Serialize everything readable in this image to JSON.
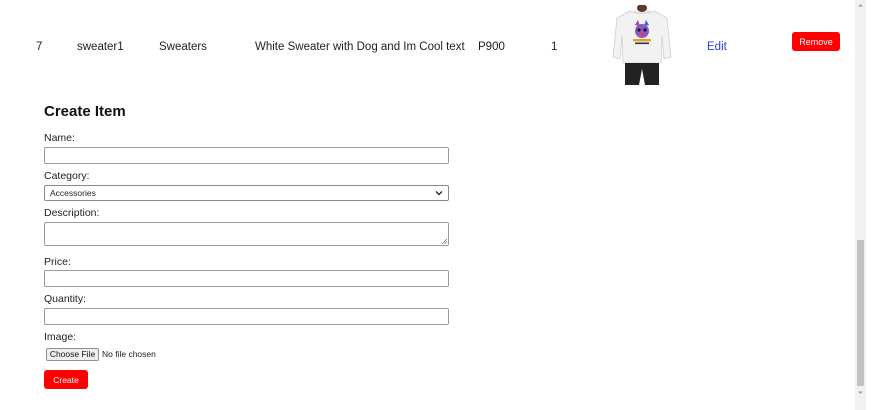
{
  "table": {
    "row": {
      "id": "7",
      "name": "sweater1",
      "category": "Sweaters",
      "description": "White Sweater with Dog and Im Cool text",
      "price": "P900",
      "quantity": "1",
      "edit_label": "Edit",
      "remove_label": "Remove"
    }
  },
  "form": {
    "title": "Create Item",
    "name_label": "Name:",
    "name_value": "",
    "category_label": "Category:",
    "category_selected": "Accessories",
    "description_label": "Description:",
    "price_label": "Price:",
    "quantity_label": "Quantity:",
    "image_label": "Image:",
    "choose_file_label": "Choose File",
    "file_status": "No file chosen",
    "create_label": "Create"
  },
  "colors": {
    "accent_red": "#ff0000",
    "link_blue": "#2a3fd6"
  }
}
